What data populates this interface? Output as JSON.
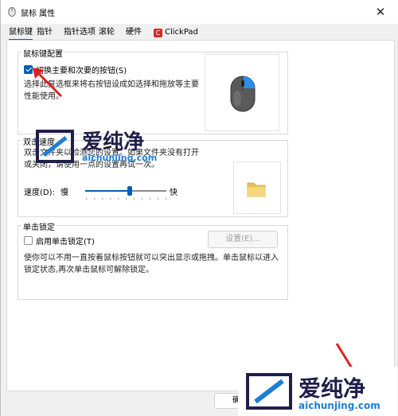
{
  "window": {
    "title": "鼠标 属性",
    "close_glyph": "✕"
  },
  "tabs": [
    {
      "label": "鼠标键",
      "active": true
    },
    {
      "label": "指针"
    },
    {
      "label": "指针选项"
    },
    {
      "label": "滚轮"
    },
    {
      "label": "硬件"
    },
    {
      "label": "ClickPad",
      "icon": "clickpad-icon"
    }
  ],
  "button_config": {
    "title": "鼠标键配置",
    "switch_checkbox": {
      "label": "切换主要和次要的按钮(S)",
      "checked": true
    },
    "description": "选择此复选框来将右按钮设成如选择和拖放等主要性能使用。",
    "preview_icon": "mouse-icon"
  },
  "double_click": {
    "title": "双击速度",
    "description": "双击文件夹以检测您的设置。如果文件夹没有打开或关闭，请使用一点的设置再试一次。",
    "speed_label": "速度(D):",
    "slow_label": "慢",
    "fast_label": "快",
    "speed_level": 0.55,
    "preview_icon": "folder-icon"
  },
  "click_lock": {
    "title": "单击锁定",
    "enable_checkbox": {
      "label": "启用单击锁定(T)",
      "checked": false
    },
    "settings_button": "设置(E)...",
    "description": "使你可以不用一直按着鼠标按钮就可以突出显示或拖拽。单击鼠标以进入锁定状态,再次单击鼠标可解除锁定。"
  },
  "footer": {
    "ok_button": "确定"
  },
  "watermark": {
    "brand": "爱纯净",
    "url": "aichunjing.com"
  },
  "colors": {
    "accent": "#005fb8",
    "annotation_arrow": "#e02020",
    "watermark_text": "#1f1f4a",
    "watermark_url": "#1d7fd4"
  }
}
